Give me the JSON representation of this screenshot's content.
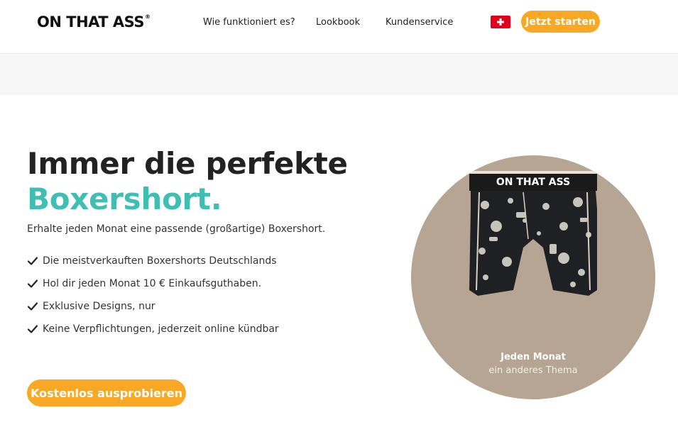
{
  "header": {
    "logo_text": "ON THAT ASS",
    "logo_mark": "®",
    "nav": [
      "Wie funktioniert es?",
      "Lookbook",
      "Kundenservice"
    ],
    "flag_icon": "swiss-flag-icon",
    "cta_label": "Jetzt starten"
  },
  "hero": {
    "headline_line1": "Immer die perfekte",
    "headline_line2": "Boxershort.",
    "subline": "Erhalte jeden Monat eine passende (großartige) Boxershort.",
    "benefits": [
      "Die meistverkauften Boxershorts Deutschlands",
      "Hol dir jeden Monat 10 € Einkaufsguthaben.",
      "Exklusive Designs, nur",
      "Keine Verpflichtungen, jederzeit online kündbar"
    ],
    "cta_label": "Kostenlos ausprobieren"
  },
  "product": {
    "waistband_text": "ON THAT ASS",
    "caption_title": "Jeden Monat",
    "caption_sub": "ein anderes Thema"
  },
  "colors": {
    "accent_orange": "#f9a826",
    "accent_teal": "#3fbfb3",
    "circle_bg": "#b5a592",
    "flag_red": "#e3001b"
  }
}
